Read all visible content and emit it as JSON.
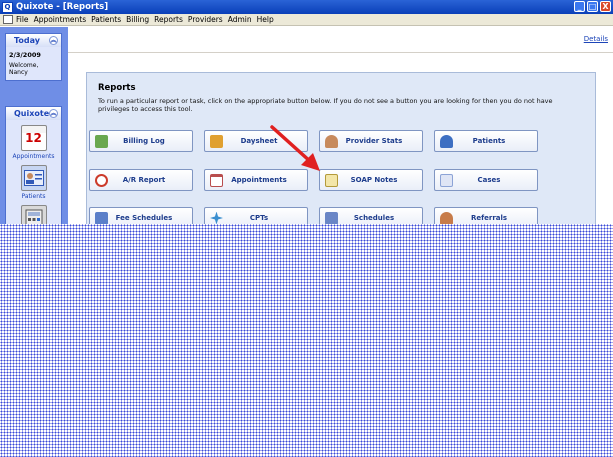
{
  "window": {
    "title": "Quixote - [Reports]",
    "buttons": [
      "_",
      "□",
      "X"
    ]
  },
  "menu": [
    "File",
    "Appointments",
    "Patients",
    "Billing",
    "Reports",
    "Providers",
    "Admin",
    "Help"
  ],
  "sidebar": {
    "today": {
      "header": "Today",
      "date": "2/3/2009",
      "welcome": "Welcome,",
      "user": "Nancy"
    },
    "quixote": {
      "header": "Quixote",
      "items": [
        {
          "label": "Appointments",
          "glyph": "12"
        },
        {
          "label": "Patients",
          "glyph": ""
        },
        {
          "label": "",
          "glyph": ""
        }
      ]
    }
  },
  "main": {
    "details_link": "Details",
    "reports": {
      "title": "Reports",
      "description": "To run a particular report or task, click on the appropriate button below.  If you do not see a button you are looking for then you do not have privileges to access this tool.",
      "buttons": [
        {
          "label": "Billing Log",
          "icon": "ledger-icon",
          "color": "#6aa84f"
        },
        {
          "label": "Daysheet",
          "icon": "clipboard-icon",
          "color": "#e0a030"
        },
        {
          "label": "Provider Stats",
          "icon": "doctor-icon",
          "color": "#c78a5c"
        },
        {
          "label": "Patients",
          "icon": "patient-icon",
          "color": "#3d6fc2"
        },
        {
          "label": "A/R Report",
          "icon": "alarm-clock-icon",
          "color": "#cc3b2b"
        },
        {
          "label": "Appointments",
          "icon": "calendar-icon",
          "color": "#b84d4d"
        },
        {
          "label": "SOAP Notes",
          "icon": "notepad-icon",
          "color": "#e5d38a"
        },
        {
          "label": "Cases",
          "icon": "folders-icon",
          "color": "#8ca3d6"
        },
        {
          "label": "Fee Schedules",
          "icon": "fee-schedule-icon",
          "color": "#5b7fc9"
        },
        {
          "label": "CPTs",
          "icon": "medical-star-icon",
          "color": "#3a8fd0"
        },
        {
          "label": "Schedules",
          "icon": "schedule-icon",
          "color": "#6a86c6"
        },
        {
          "label": "Referrals",
          "icon": "referral-people-icon",
          "color": "#c77c4a"
        }
      ]
    }
  },
  "colors": {
    "titlebar": "#0a3fb8",
    "sidebar": "#6f8ee6",
    "arrow": "#e02020",
    "overlay_dots": "#3a49d8"
  }
}
